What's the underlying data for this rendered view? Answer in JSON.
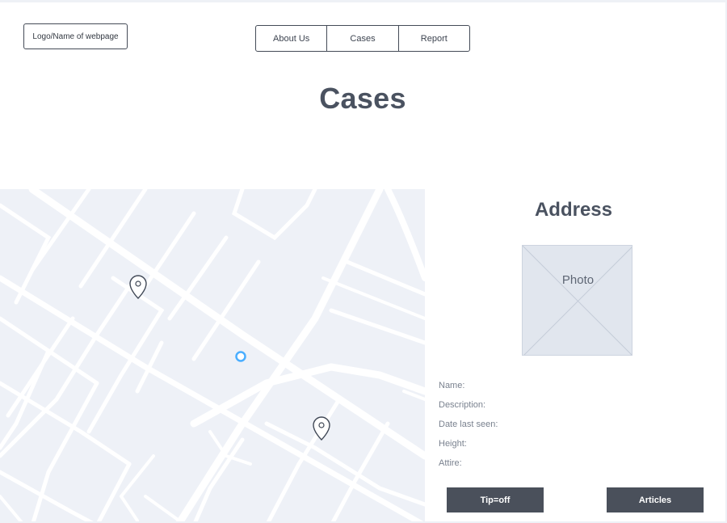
{
  "header": {
    "logo_text": "Logo/Name of webpage"
  },
  "nav": {
    "items": [
      {
        "label": "About Us"
      },
      {
        "label": "Cases"
      },
      {
        "label": "Report"
      }
    ]
  },
  "page_title": "Cases",
  "map": {
    "markers": [
      {
        "icon": "map-pin-icon"
      },
      {
        "icon": "map-pin-icon"
      }
    ],
    "current_location_icon": "location-dot-icon",
    "accent_color": "#4aaeff"
  },
  "detail_panel": {
    "title": "Address",
    "photo_label": "Photo",
    "fields": [
      {
        "label": "Name:"
      },
      {
        "label": "Description:"
      },
      {
        "label": "Date  last seen:"
      },
      {
        "label": "Height:"
      },
      {
        "label": "Attire:"
      }
    ],
    "buttons": {
      "tipoff": "Tip=off",
      "articles": "Articles"
    }
  },
  "colors": {
    "button_bg": "#4a505b",
    "title_text": "#4a5260",
    "map_bg": "#eef1f7",
    "map_roads": "#ffffff"
  }
}
